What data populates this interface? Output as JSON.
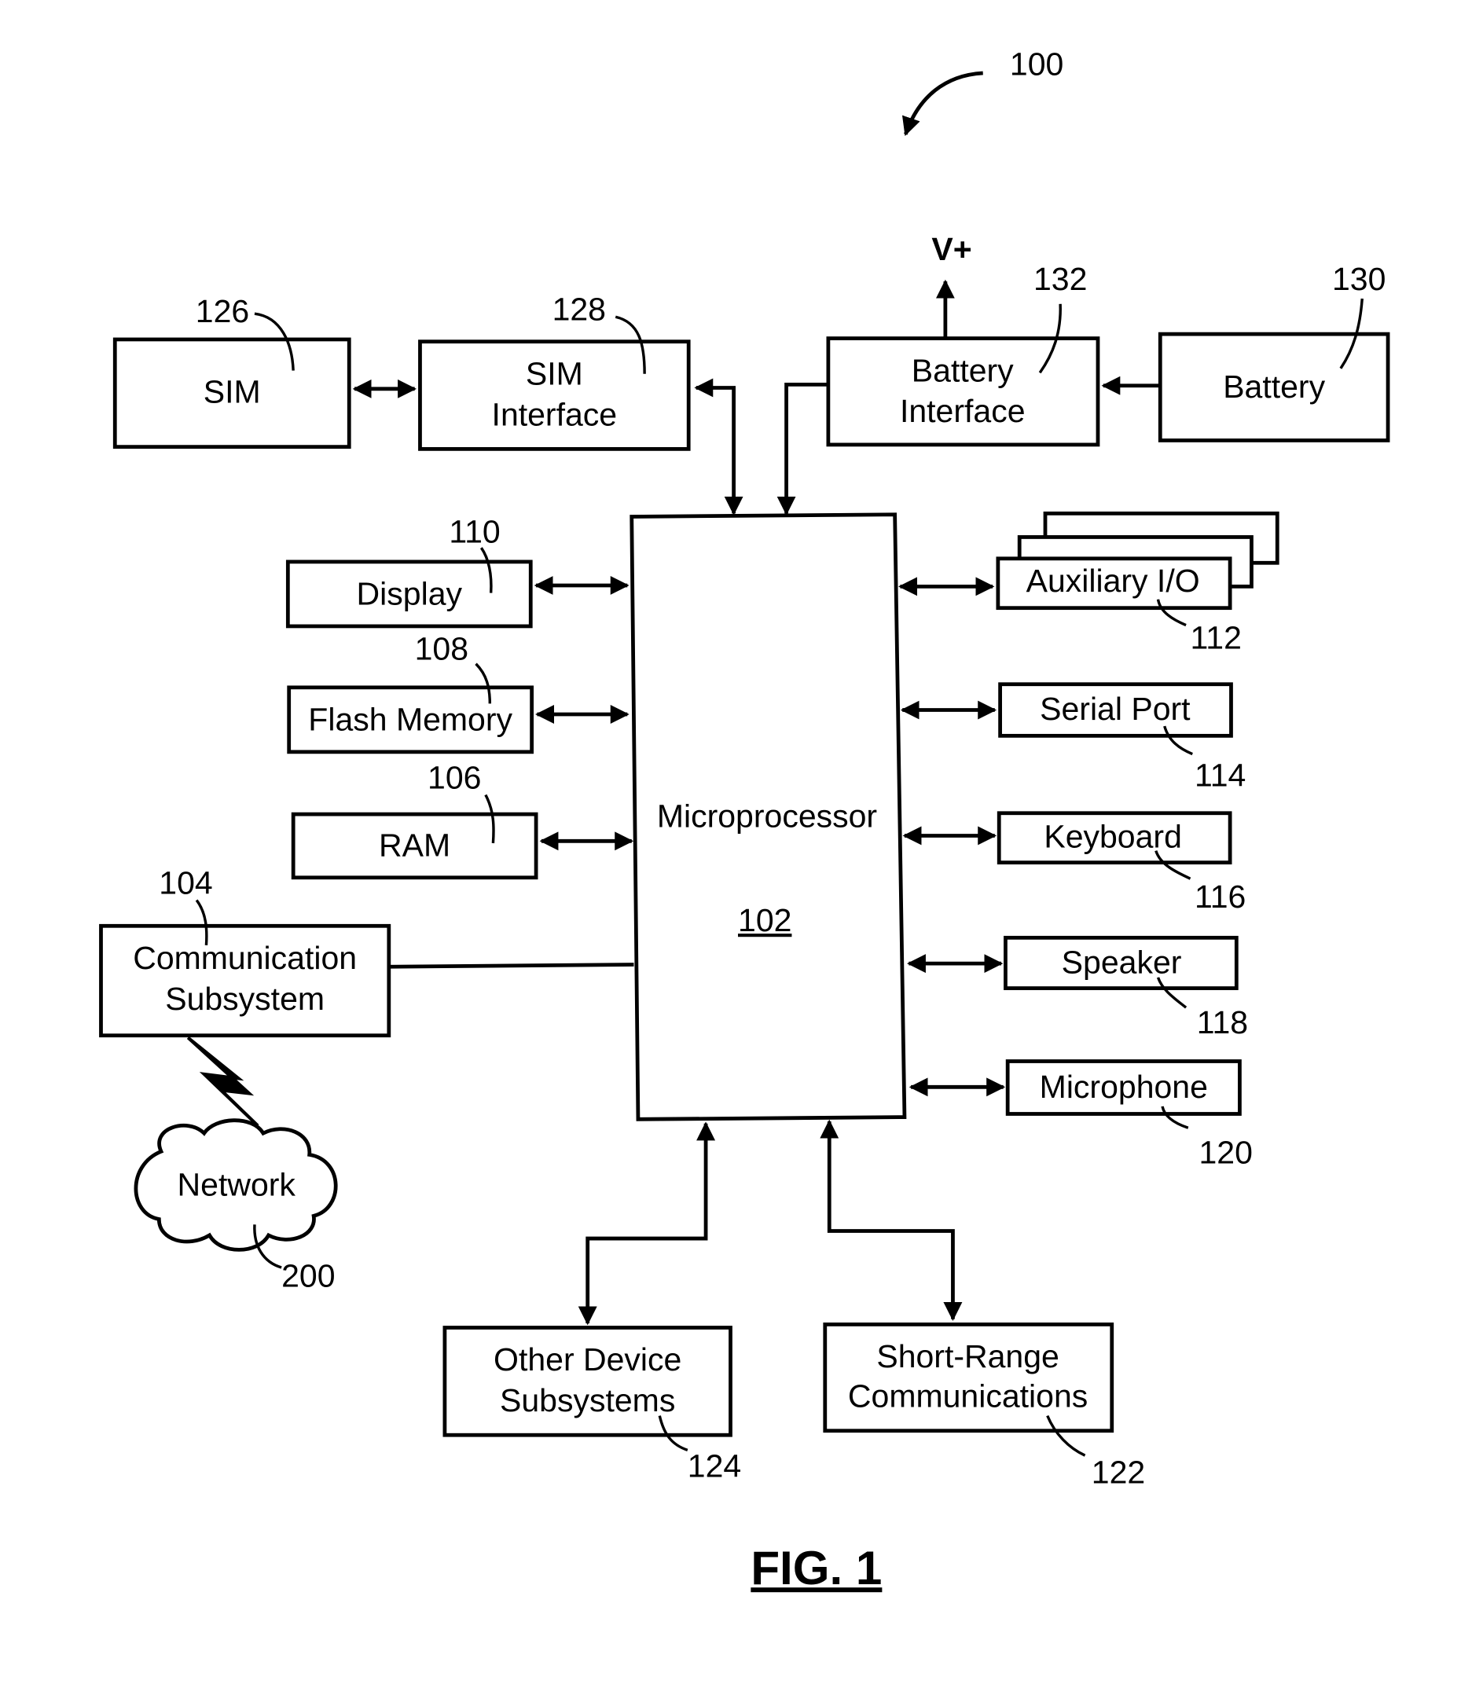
{
  "figure": {
    "ref": "100",
    "caption": "FIG. 1",
    "vplus": "V+"
  },
  "blocks": {
    "sim": {
      "label": "SIM",
      "ref": "126"
    },
    "sim_interface": {
      "line1": "SIM",
      "line2": "Interface",
      "ref": "128"
    },
    "battery_interface": {
      "line1": "Battery",
      "line2": "Interface",
      "ref": "132"
    },
    "battery": {
      "label": "Battery",
      "ref": "130"
    },
    "display": {
      "label": "Display",
      "ref": "110"
    },
    "flash_memory": {
      "label": "Flash Memory",
      "ref": "108"
    },
    "ram": {
      "label": "RAM",
      "ref": "106"
    },
    "communication_subsystem": {
      "line1": "Communication",
      "line2": "Subsystem",
      "ref": "104"
    },
    "network": {
      "label": "Network",
      "ref": "200"
    },
    "microprocessor": {
      "label": "Microprocessor",
      "ref": "102"
    },
    "auxiliary_io": {
      "label": "Auxiliary I/O",
      "ref": "112"
    },
    "serial_port": {
      "label": "Serial Port",
      "ref": "114"
    },
    "keyboard": {
      "label": "Keyboard",
      "ref": "116"
    },
    "speaker": {
      "label": "Speaker",
      "ref": "118"
    },
    "microphone": {
      "label": "Microphone",
      "ref": "120"
    },
    "other_device_subsystems": {
      "line1": "Other Device",
      "line2": "Subsystems",
      "ref": "124"
    },
    "short_range_communications": {
      "line1": "Short-Range",
      "line2": "Communications",
      "ref": "122"
    }
  }
}
